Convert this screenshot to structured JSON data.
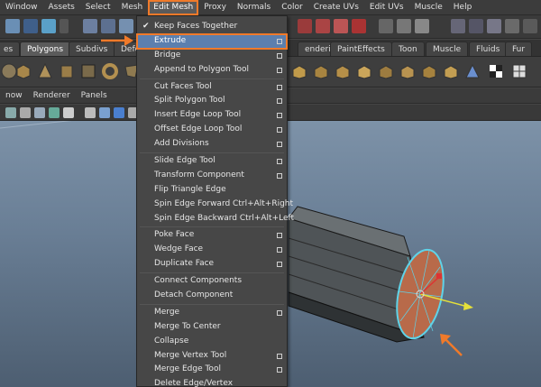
{
  "menubar": {
    "items": [
      "Window",
      "Assets",
      "Select",
      "Mesh",
      "Edit Mesh",
      "Proxy",
      "Normals",
      "Color",
      "Create UVs",
      "Edit UVs",
      "Muscle",
      "Help"
    ],
    "active_index": 4
  },
  "shelf_tabs": {
    "items": [
      "es",
      "Polygons",
      "Subdivs",
      "Defo",
      "endering",
      "PaintEffects",
      "Toon",
      "Muscle",
      "Fluids",
      "Fur"
    ],
    "active_index": 1
  },
  "panel_menu": {
    "items": [
      "now",
      "Renderer",
      "Panels"
    ]
  },
  "dropdown": {
    "title": "Edit Mesh",
    "groups": [
      [
        {
          "label": "Keep Faces Together",
          "checked": true,
          "option_box": false
        },
        {
          "label": "Extrude",
          "checked": false,
          "option_box": true,
          "highlight": true
        },
        {
          "label": "Bridge",
          "option_box": true
        },
        {
          "label": "Append to Polygon Tool",
          "option_box": true
        }
      ],
      [
        {
          "label": "Cut Faces Tool",
          "option_box": true
        },
        {
          "label": "Split Polygon Tool",
          "option_box": true
        },
        {
          "label": "Insert Edge Loop Tool",
          "option_box": true
        },
        {
          "label": "Offset Edge Loop Tool",
          "option_box": true
        },
        {
          "label": "Add Divisions",
          "option_box": true
        }
      ],
      [
        {
          "label": "Slide Edge Tool",
          "option_box": true
        },
        {
          "label": "Transform Component",
          "option_box": true
        },
        {
          "label": "Flip Triangle Edge",
          "option_box": false
        },
        {
          "label": "Spin Edge Forward  Ctrl+Alt+Right",
          "option_box": false
        },
        {
          "label": "Spin Edge Backward  Ctrl+Alt+Left",
          "option_box": false
        }
      ],
      [
        {
          "label": "Poke Face",
          "option_box": true
        },
        {
          "label": "Wedge Face",
          "option_box": true
        },
        {
          "label": "Duplicate Face",
          "option_box": true
        }
      ],
      [
        {
          "label": "Connect Components",
          "option_box": false
        },
        {
          "label": "Detach Component",
          "option_box": false
        }
      ],
      [
        {
          "label": "Merge",
          "option_box": true
        },
        {
          "label": "Merge To Center",
          "option_box": false
        },
        {
          "label": "Collapse",
          "option_box": false
        },
        {
          "label": "Merge Vertex Tool",
          "option_box": true
        },
        {
          "label": "Merge Edge Tool",
          "option_box": true
        },
        {
          "label": "Delete Edge/Vertex",
          "option_box": false
        }
      ]
    ]
  },
  "colors": {
    "accent": "#f07a2a",
    "highlight": "#5c7fae",
    "menu_bg": "#474747",
    "selection": "#5fd3e8",
    "face": "#b86a4a"
  }
}
